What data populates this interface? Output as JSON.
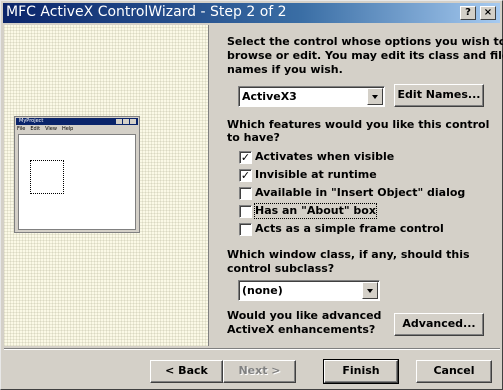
{
  "window": {
    "title": "MFC ActiveX ControlWizard - Step 2 of 2",
    "help_button": "?",
    "close_button": "×"
  },
  "preview": {
    "title": "MyProject",
    "menu": [
      "File",
      "Edit",
      "View",
      "Help"
    ]
  },
  "control_select": {
    "instructions_lines": [
      "Select the control whose options you wish to",
      "browse or edit.  You may edit its class and file",
      "names if you wish."
    ],
    "selected": "ActiveX3",
    "edit_names_label": "Edit Names..."
  },
  "features": {
    "question_lines": [
      "Which features would you like this control",
      "to have?"
    ],
    "options": [
      {
        "label": "Activates when visible",
        "checked": true
      },
      {
        "label": "Invisible at runtime",
        "checked": true
      },
      {
        "label": "Available in \"Insert Object\" dialog",
        "checked": false
      },
      {
        "label": "Has an \"About\" box",
        "checked": false
      },
      {
        "label": "Acts as a simple frame control",
        "checked": false
      }
    ]
  },
  "subclass": {
    "question_lines": [
      "Which window class, if any, should this",
      "control subclass?"
    ],
    "selected": "(none)"
  },
  "advanced": {
    "question_lines": [
      "Would you like advanced",
      "ActiveX enhancements?"
    ],
    "button_label": "Advanced..."
  },
  "footer": {
    "back_label": "< Back",
    "next_label": "Next >",
    "finish_label": "Finish",
    "cancel_label": "Cancel"
  }
}
